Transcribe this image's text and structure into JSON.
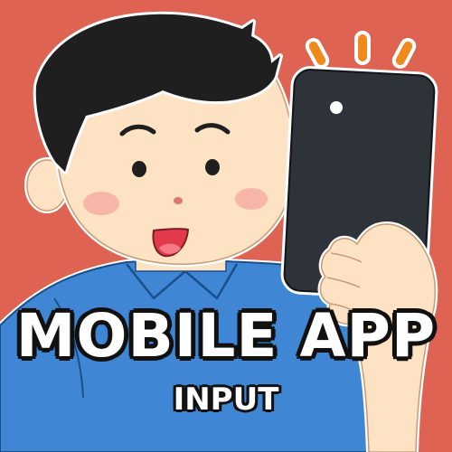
{
  "title": "MOBILE APP",
  "subtitle": "INPUT",
  "colors": {
    "background": "#de6352",
    "shirt": "#3f86d4",
    "skin": "#fde2c4",
    "hair": "#1f1f1f",
    "phone": "#2e3239",
    "alert": "#f08a1c",
    "text": "#ffffff",
    "text_outline": "#111111"
  },
  "icons": [
    "person-illustration",
    "smartphone-icon",
    "notification-burst-icon"
  ]
}
